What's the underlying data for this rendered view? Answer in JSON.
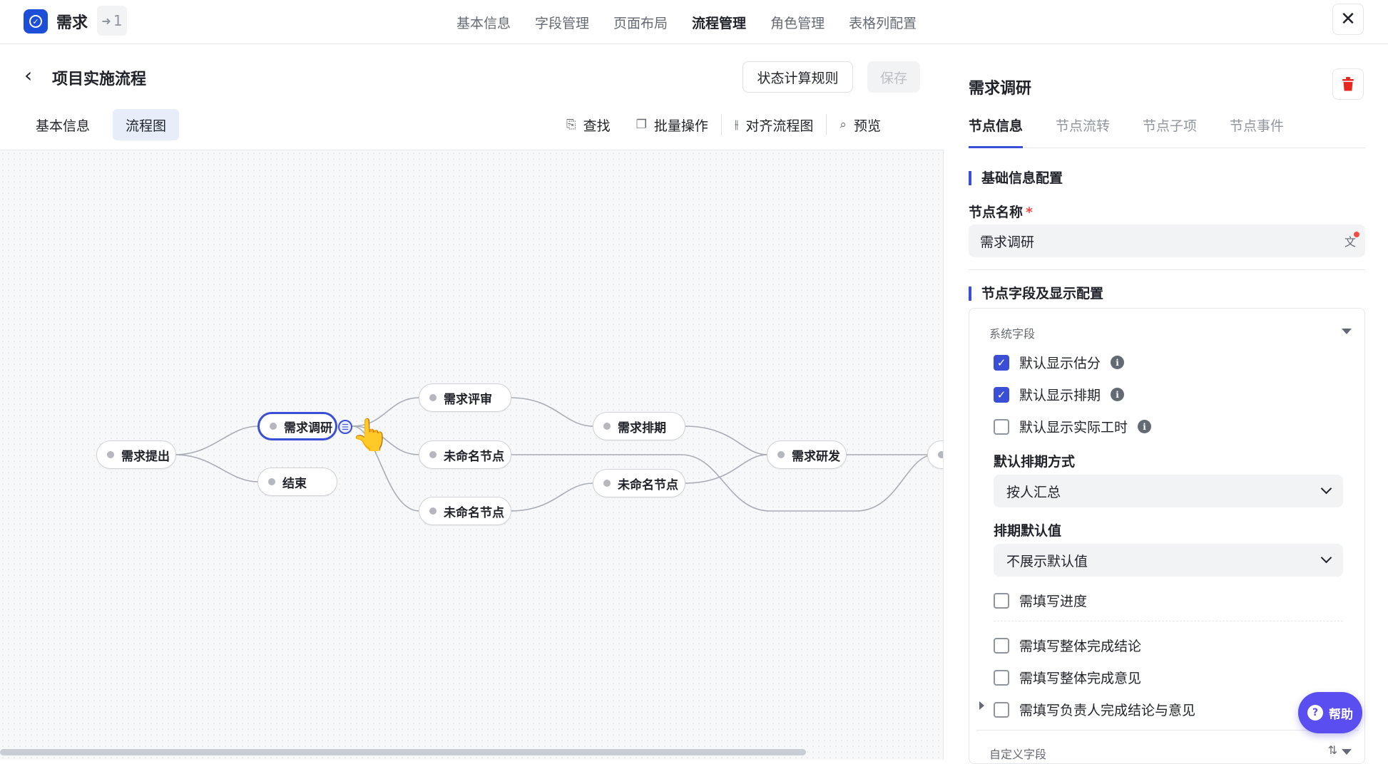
{
  "app": {
    "title": "需求",
    "share_count": "1"
  },
  "nav": {
    "tabs": [
      "基本信息",
      "字段管理",
      "页面布局",
      "流程管理",
      "角色管理",
      "表格列配置"
    ],
    "active": "流程管理"
  },
  "header": {
    "flow_title": "项目实施流程",
    "rules_label": "状态计算规则",
    "save_label": "保存",
    "subtabs": [
      "基本信息",
      "流程图"
    ],
    "tools": [
      "查找",
      "批量操作",
      "对齐流程图",
      "预览"
    ]
  },
  "canvas": {
    "nodes": {
      "n1": "需求提出",
      "n2": "需求调研",
      "n3": "结束",
      "n4": "需求评审",
      "n5": "未命名节点",
      "n6": "未命名节点",
      "n7": "需求排期",
      "n8": "未命名节点",
      "n9": "需求研发"
    }
  },
  "panel": {
    "title": "需求调研",
    "tabs": [
      "节点信息",
      "节点流转",
      "节点子项",
      "节点事件"
    ],
    "section1": "基础信息配置",
    "name_label": "节点名称",
    "required_mark": "*",
    "name_value": "需求调研",
    "section2": "节点字段及显示配置",
    "system_fields_label": "系统字段",
    "cb_show_estimate": "默认显示估分",
    "cb_show_schedule": "默认显示排期",
    "cb_show_actual_hours": "默认显示实际工时",
    "schedule_mode_label": "默认排期方式",
    "schedule_mode_value": "按人汇总",
    "schedule_default_label": "排期默认值",
    "schedule_default_value": "不展示默认值",
    "cb_progress": "需填写进度",
    "cb_overall_conclusion": "需填写整体完成结论",
    "cb_overall_opinion": "需填写整体完成意见",
    "cb_owner_conclusion": "需填写负责人完成结论与意见",
    "custom_fields_label": "自定义字段"
  },
  "help": {
    "label": "帮助"
  },
  "colors": {
    "accent": "#3b4fd6",
    "brand": "#1d4ed8",
    "help": "#5b4ef0",
    "danger": "#f54a45"
  }
}
